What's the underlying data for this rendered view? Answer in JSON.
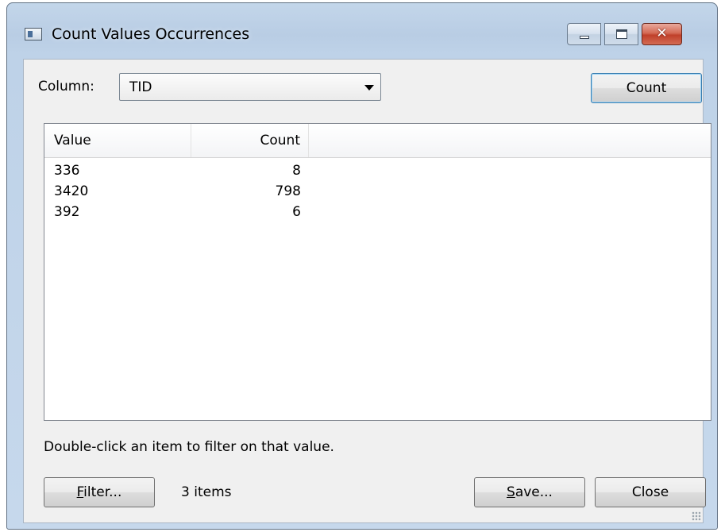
{
  "window": {
    "title": "Count Values Occurrences",
    "close_glyph": "✕"
  },
  "column_selector": {
    "label": "Column:",
    "selected": "TID"
  },
  "buttons": {
    "count": "Count",
    "filter_key": "F",
    "filter_rest": "ilter...",
    "save_key": "S",
    "save_rest": "ave...",
    "close": "Close"
  },
  "list": {
    "columns": [
      "Value",
      "Count"
    ],
    "rows": [
      {
        "value": "336",
        "count": "8"
      },
      {
        "value": "3420",
        "count": "798"
      },
      {
        "value": "392",
        "count": "6"
      }
    ]
  },
  "hint": "Double-click an item to filter on that value.",
  "status": "3 items",
  "colors": {
    "frame": "#bed2e8",
    "client": "#f0f0f0",
    "close_button": "#c0402a",
    "default_button_border": "#3c7fb1"
  },
  "icons": [
    "app-icon",
    "minimize-icon",
    "maximize-icon",
    "close-icon",
    "dropdown-arrow-icon",
    "resize-grip-icon"
  ]
}
